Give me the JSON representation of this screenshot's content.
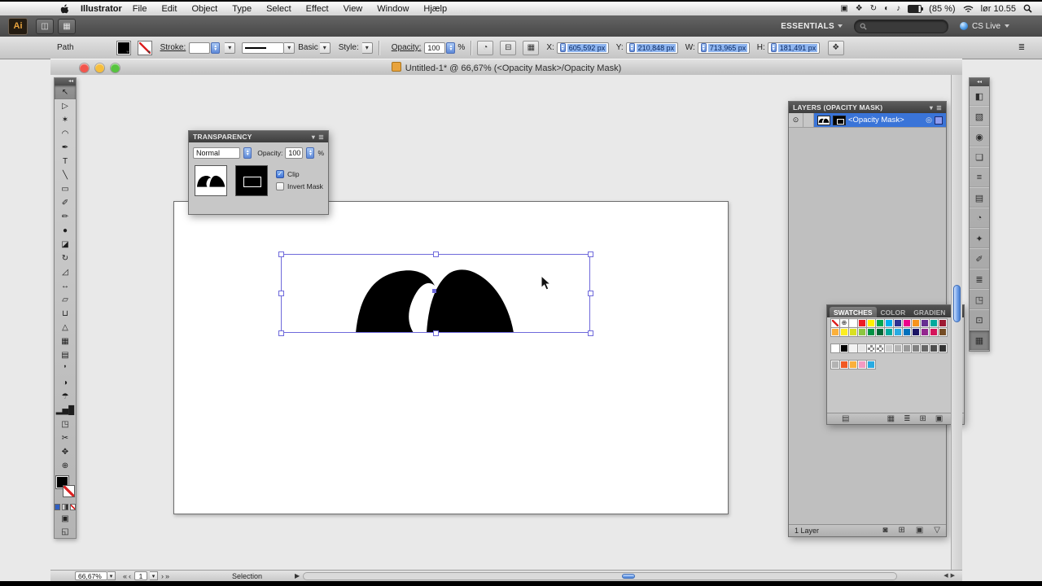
{
  "menubar": {
    "app_name": "Illustrator",
    "items": [
      "File",
      "Edit",
      "Object",
      "Type",
      "Select",
      "Effect",
      "View",
      "Window",
      "Hjælp"
    ],
    "status_icons": [
      {
        "name": "display-menu-icon",
        "glyph": "▣"
      },
      {
        "name": "spaces-menu-icon",
        "glyph": "❖"
      },
      {
        "name": "time-machine-menu-icon",
        "glyph": "↻"
      },
      {
        "name": "keyboard-menu-icon",
        "glyph": "◐"
      },
      {
        "name": "volume-menu-icon",
        "glyph": "♪"
      }
    ],
    "battery": "(85 %)",
    "clock": "lør 10.55"
  },
  "appbar": {
    "logo": "Ai",
    "buttons": [
      {
        "name": "go-to-bridge-button",
        "glyph": "◫"
      },
      {
        "name": "arrange-documents-button",
        "glyph": "▦"
      }
    ],
    "workspace": "ESSENTIALS",
    "cs_live": "CS Live",
    "search_value": ""
  },
  "controlbar": {
    "object_label": "Path",
    "stroke_label": "Stroke:",
    "stroke_value": "",
    "brush_label": "Basic",
    "style_label": "Style:",
    "opacity_label": "Opacity:",
    "opacity_value": "100",
    "opacity_unit": "%",
    "icons": [
      {
        "name": "recolor-artwork-button",
        "glyph": "◔"
      },
      {
        "name": "align-button",
        "glyph": "⊟"
      },
      {
        "name": "isolate-selected-object-button",
        "glyph": "▦"
      }
    ],
    "x_label": "X:",
    "x_value": "605,592 px",
    "y_label": "Y:",
    "y_value": "210,848 px",
    "w_label": "W:",
    "w_value": "713,965 px",
    "h_label": "H:",
    "h_value": "181,491 px",
    "menu_icon": {
      "name": "control-panel-menu-icon",
      "glyph": "≣"
    }
  },
  "document": {
    "title": "Untitled-1* @ 66,67% (<Opacity Mask>/Opacity Mask)"
  },
  "toolbar": {
    "tools": [
      {
        "name": "selection-tool",
        "glyph": "↖",
        "active": true
      },
      {
        "name": "direct-selection-tool",
        "glyph": "▷"
      },
      {
        "name": "magic-wand-tool",
        "glyph": "✶"
      },
      {
        "name": "lasso-tool",
        "glyph": "◠"
      },
      {
        "name": "pen-tool",
        "glyph": "✒"
      },
      {
        "name": "type-tool",
        "glyph": "T"
      },
      {
        "name": "line-segment-tool",
        "glyph": "╲"
      },
      {
        "name": "rectangle-tool",
        "glyph": "▭"
      },
      {
        "name": "paintbrush-tool",
        "glyph": "✐"
      },
      {
        "name": "pencil-tool",
        "glyph": "✏"
      },
      {
        "name": "blob-brush-tool",
        "glyph": "●"
      },
      {
        "name": "eraser-tool",
        "glyph": "◪"
      },
      {
        "name": "rotate-tool",
        "glyph": "↻"
      },
      {
        "name": "scale-tool",
        "glyph": "◿"
      },
      {
        "name": "width-tool",
        "glyph": "↔"
      },
      {
        "name": "free-transform-tool",
        "glyph": "▱"
      },
      {
        "name": "shape-builder-tool",
        "glyph": "⊔"
      },
      {
        "name": "perspective-grid-tool",
        "glyph": "△"
      },
      {
        "name": "mesh-tool",
        "glyph": "▦"
      },
      {
        "name": "gradient-tool",
        "glyph": "▤"
      },
      {
        "name": "eyedropper-tool",
        "glyph": "❜"
      },
      {
        "name": "blend-tool",
        "glyph": "◑"
      },
      {
        "name": "symbol-sprayer-tool",
        "glyph": "☂"
      },
      {
        "name": "column-graph-tool",
        "glyph": "▂▅█"
      },
      {
        "name": "artboard-tool",
        "glyph": "◳"
      },
      {
        "name": "slice-tool",
        "glyph": "✂"
      },
      {
        "name": "hand-tool",
        "glyph": "✥"
      },
      {
        "name": "zoom-tool",
        "glyph": "⊕"
      }
    ]
  },
  "transparency": {
    "title": "TRANSPARENCY",
    "blend_mode": "Normal",
    "opacity_label": "Opacity:",
    "opacity_value": "100",
    "opacity_unit": "%",
    "clip_label": "Clip",
    "invert_label": "Invert Mask"
  },
  "layers": {
    "title": "LAYERS (OPACITY MASK)",
    "mask_name": "<Opacity Mask>",
    "count": "1 Layer",
    "buttons": [
      {
        "name": "make-clipping-mask-button",
        "glyph": "◙"
      },
      {
        "name": "new-sublayer-button",
        "glyph": "⊞"
      },
      {
        "name": "new-layer-button",
        "glyph": "▣"
      },
      {
        "name": "delete-layer-button",
        "glyph": "▽"
      }
    ]
  },
  "swatches": {
    "tabs": [
      "SWATCHES",
      "COLOR",
      "GRADIEN"
    ],
    "more": "»",
    "rows": [
      [
        "none",
        "registration",
        "#ffffff",
        "#ed1c24",
        "#fff200",
        "#00a651",
        "#00aeef",
        "#2e3192",
        "#ec008c",
        "#f7941d",
        "#662d91",
        "#00a99d",
        "#9e1b32"
      ],
      [
        "#fbb03b",
        "#fcee21",
        "#d9e021",
        "#8cc63f",
        "#009245",
        "#006837",
        "#00a99d",
        "#29abe2",
        "#0071bc",
        "#1b1464",
        "#93278f",
        "#d4145a",
        "#754c24"
      ],
      [
        "#ffffff",
        "#000000",
        "#f2f2f2",
        "#e6e6e6",
        "pattern",
        "pattern",
        "#cccccc",
        "#b3b3b3",
        "#999999",
        "#808080",
        "#666666",
        "#4d4d4d",
        "#333333"
      ],
      [
        "#b3b3b3",
        "#f15a24",
        "#fbb03b",
        "#f49ac2",
        "#29abe2"
      ]
    ],
    "buttons": [
      {
        "name": "swatch-libraries-button",
        "glyph": "▤"
      },
      {
        "name": "show-swatch-kinds-button",
        "glyph": "▦"
      },
      {
        "name": "swatch-options-button",
        "glyph": "≣"
      },
      {
        "name": "new-color-group-button",
        "glyph": "⊞"
      },
      {
        "name": "new-swatch-button",
        "glyph": "▣"
      },
      {
        "name": "delete-swatch-button",
        "glyph": "▽"
      }
    ]
  },
  "dock": {
    "icons": [
      {
        "name": "dock-color-icon",
        "glyph": "◧"
      },
      {
        "name": "dock-color-guide-icon",
        "glyph": "▧"
      },
      {
        "name": "dock-appearance-icon",
        "glyph": "◉"
      },
      {
        "name": "dock-graphic-styles-icon",
        "glyph": "❏"
      },
      {
        "name": "dock-stroke-icon",
        "glyph": "≡"
      },
      {
        "name": "dock-gradient-icon",
        "glyph": "▤"
      },
      {
        "name": "dock-transparency-icon",
        "glyph": "◔"
      },
      {
        "name": "dock-symbols-icon",
        "glyph": "✦"
      },
      {
        "name": "dock-brushes-icon",
        "glyph": "✐"
      },
      {
        "name": "dock-layers-icon",
        "glyph": "≣"
      },
      {
        "name": "dock-artboards-icon",
        "glyph": "◳"
      },
      {
        "name": "dock-links-icon",
        "glyph": "⊡"
      },
      {
        "name": "dock-swatches-icon",
        "glyph": "▦",
        "active": true
      }
    ]
  },
  "statusbar": {
    "zoom": "66,67%",
    "nav": [
      {
        "name": "first-artboard-button",
        "glyph": "«"
      },
      {
        "name": "previous-artboard-button",
        "glyph": "‹"
      }
    ],
    "nav2": [
      {
        "name": "next-artboard-button",
        "glyph": "›"
      },
      {
        "name": "last-artboard-button",
        "glyph": "»"
      }
    ],
    "artboard": "1",
    "mode": "Selection",
    "menu_arrow": "▶"
  },
  "colors": {
    "selection_outline": "#6f6adb",
    "layer_highlight": "#3a74d8",
    "artwork_fill": "#000000",
    "aqua_scrollbar": "#6f9fe8"
  }
}
